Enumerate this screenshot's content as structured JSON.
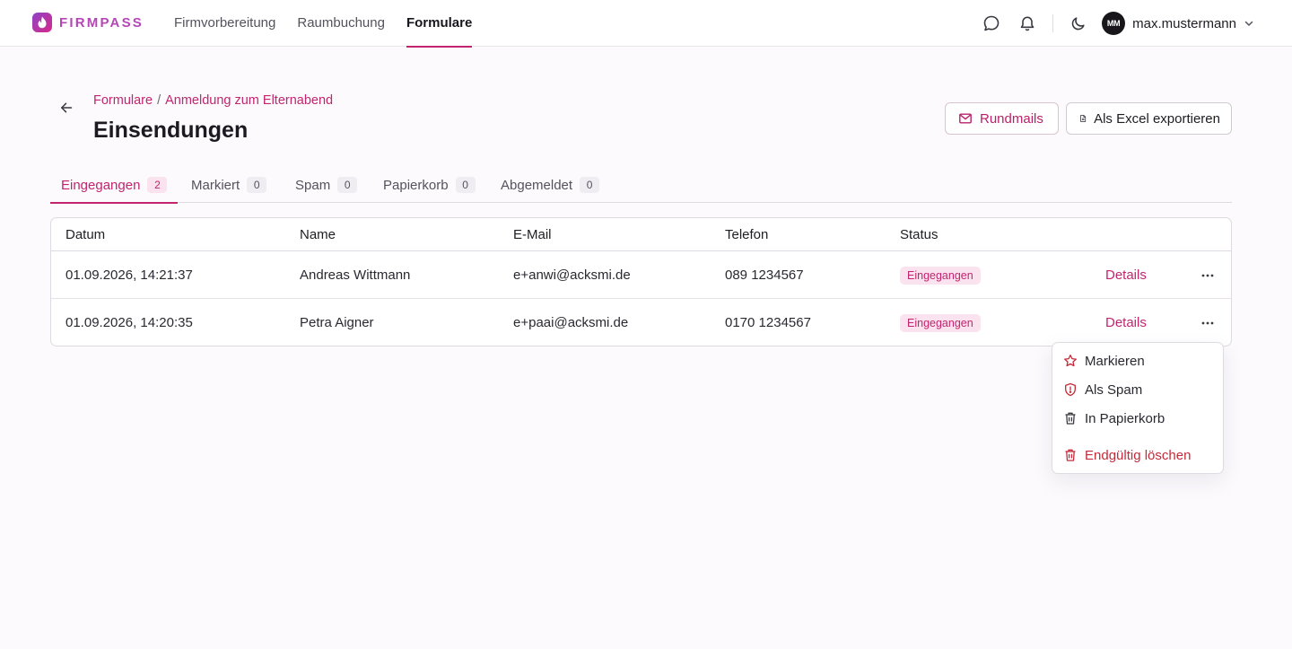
{
  "app": {
    "brand": "FIRMPASS",
    "colors": {
      "accent": "#c2246f",
      "danger": "#c42a3a",
      "badge_bg": "#fae3ee"
    }
  },
  "nav": {
    "items": [
      {
        "label": "Firmvorbereitung",
        "active": false
      },
      {
        "label": "Raumbuchung",
        "active": false
      },
      {
        "label": "Formulare",
        "active": true
      }
    ]
  },
  "user": {
    "initials": "MM",
    "name": "max.mustermann"
  },
  "header": {
    "breadcrumb": [
      "Formulare",
      "Anmeldung zum Elternabend"
    ],
    "breadcrumb_sep": "/",
    "title": "Einsendungen",
    "actions": {
      "mail_label": "Rundmails",
      "export_label": "Als Excel exportieren"
    }
  },
  "tabs": [
    {
      "label": "Eingegangen",
      "count": "2",
      "active": true
    },
    {
      "label": "Markiert",
      "count": "0",
      "active": false
    },
    {
      "label": "Spam",
      "count": "0",
      "active": false
    },
    {
      "label": "Papierkorb",
      "count": "0",
      "active": false
    },
    {
      "label": "Abgemeldet",
      "count": "0",
      "active": false
    }
  ],
  "table": {
    "columns": [
      "Datum",
      "Name",
      "E-Mail",
      "Telefon",
      "Status"
    ],
    "rows": [
      {
        "date": "01.09.2026, 14:21:37",
        "name": "Andreas Wittmann",
        "email": "e+anwi@acksmi.de",
        "phone": "089 1234567",
        "status": "Eingegangen",
        "action": "Details"
      },
      {
        "date": "01.09.2026, 14:20:35",
        "name": "Petra Aigner",
        "email": "e+paai@acksmi.de",
        "phone": "0170 1234567",
        "status": "Eingegangen",
        "action": "Details"
      }
    ]
  },
  "menu": {
    "items": [
      {
        "label": "Markieren",
        "icon": "star-icon"
      },
      {
        "label": "Als Spam",
        "icon": "shield-alert-icon"
      },
      {
        "label": "In Papierkorb",
        "icon": "trash-icon"
      },
      {
        "label": "Endgültig löschen",
        "icon": "trash-icon",
        "danger": true
      }
    ]
  }
}
